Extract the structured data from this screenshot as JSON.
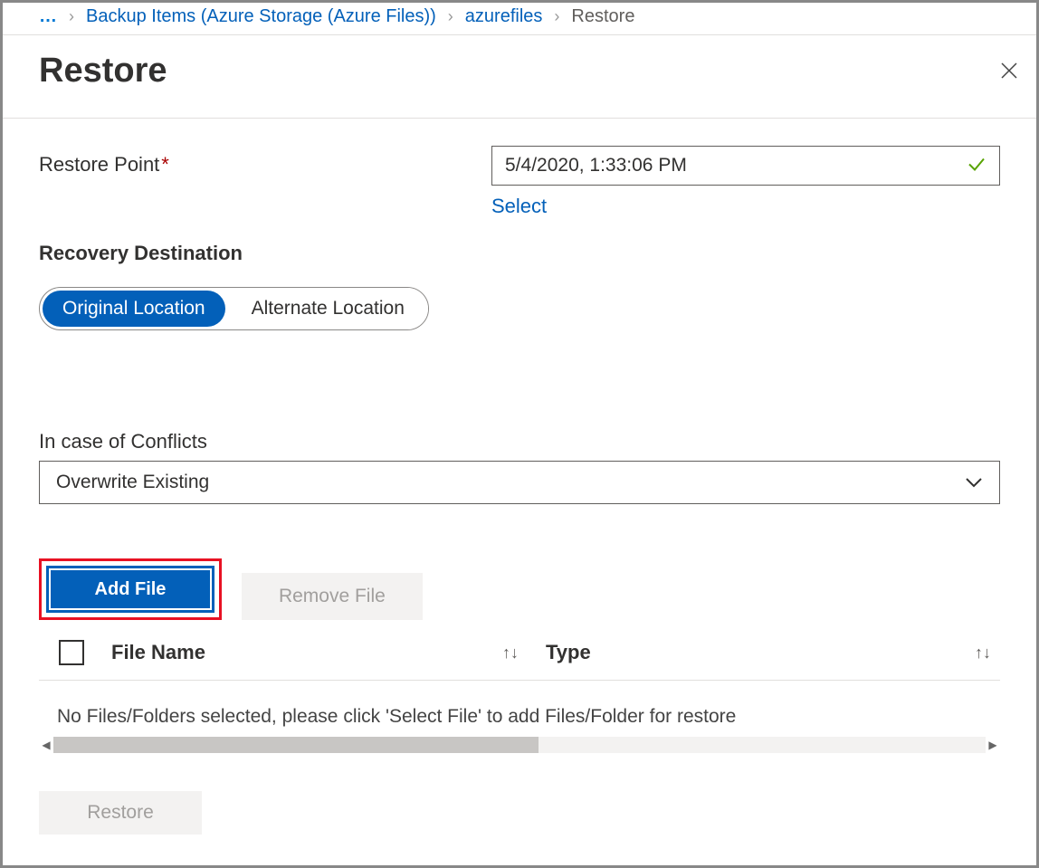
{
  "breadcrumb": {
    "ellipsis": "…",
    "items": [
      {
        "label": "Backup Items (Azure Storage (Azure Files))",
        "link": true
      },
      {
        "label": "azurefiles",
        "link": true
      },
      {
        "label": "Restore",
        "link": false
      }
    ]
  },
  "header": {
    "title": "Restore"
  },
  "restorePoint": {
    "label": "Restore Point",
    "value": "5/4/2020, 1:33:06 PM",
    "selectLink": "Select"
  },
  "recoveryDestination": {
    "title": "Recovery Destination",
    "options": {
      "original": "Original Location",
      "alternate": "Alternate Location"
    }
  },
  "conflicts": {
    "label": "In case of Conflicts",
    "value": "Overwrite Existing"
  },
  "fileActions": {
    "add": "Add File",
    "remove": "Remove File"
  },
  "table": {
    "columns": {
      "filename": "File Name",
      "type": "Type"
    },
    "emptyMessage": "No Files/Folders selected, please click 'Select File' to add Files/Folder for restore"
  },
  "footer": {
    "restore": "Restore"
  }
}
